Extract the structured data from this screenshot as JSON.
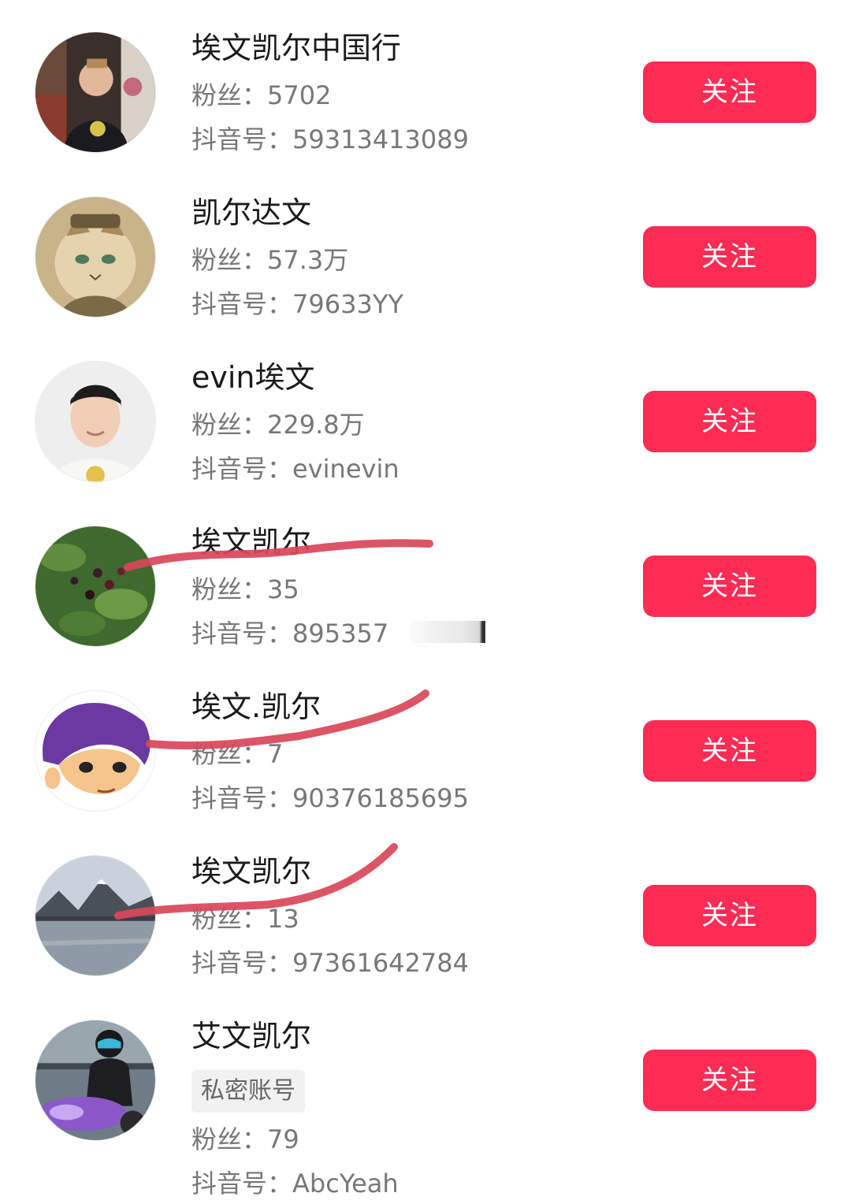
{
  "follow_label": "关注",
  "followers_prefix": "粉丝：",
  "id_prefix": "抖音号：",
  "users": [
    {
      "name": "埃文凯尔中国行",
      "followers": "5702",
      "douyin_id": "59313413089"
    },
    {
      "name": "凯尔达文",
      "followers": "57.3万",
      "douyin_id": "79633YY"
    },
    {
      "name": "evin埃文",
      "followers": "229.8万",
      "douyin_id": "evinevin"
    },
    {
      "name": "埃文凯尔",
      "followers": "35",
      "douyin_id": "895357"
    },
    {
      "name": "埃文.凯尔",
      "followers": "7",
      "douyin_id": "90376185695"
    },
    {
      "name": "埃文凯尔",
      "followers": "13",
      "douyin_id": "97361642784"
    },
    {
      "name": "艾文凯尔",
      "private_badge": "私密账号",
      "followers": "79",
      "douyin_id": "AbcYeah"
    }
  ],
  "colors": {
    "follow_button": "#fe2c55",
    "annotation_stroke": "#d9475a"
  },
  "icons": [
    "avatar-photo"
  ]
}
